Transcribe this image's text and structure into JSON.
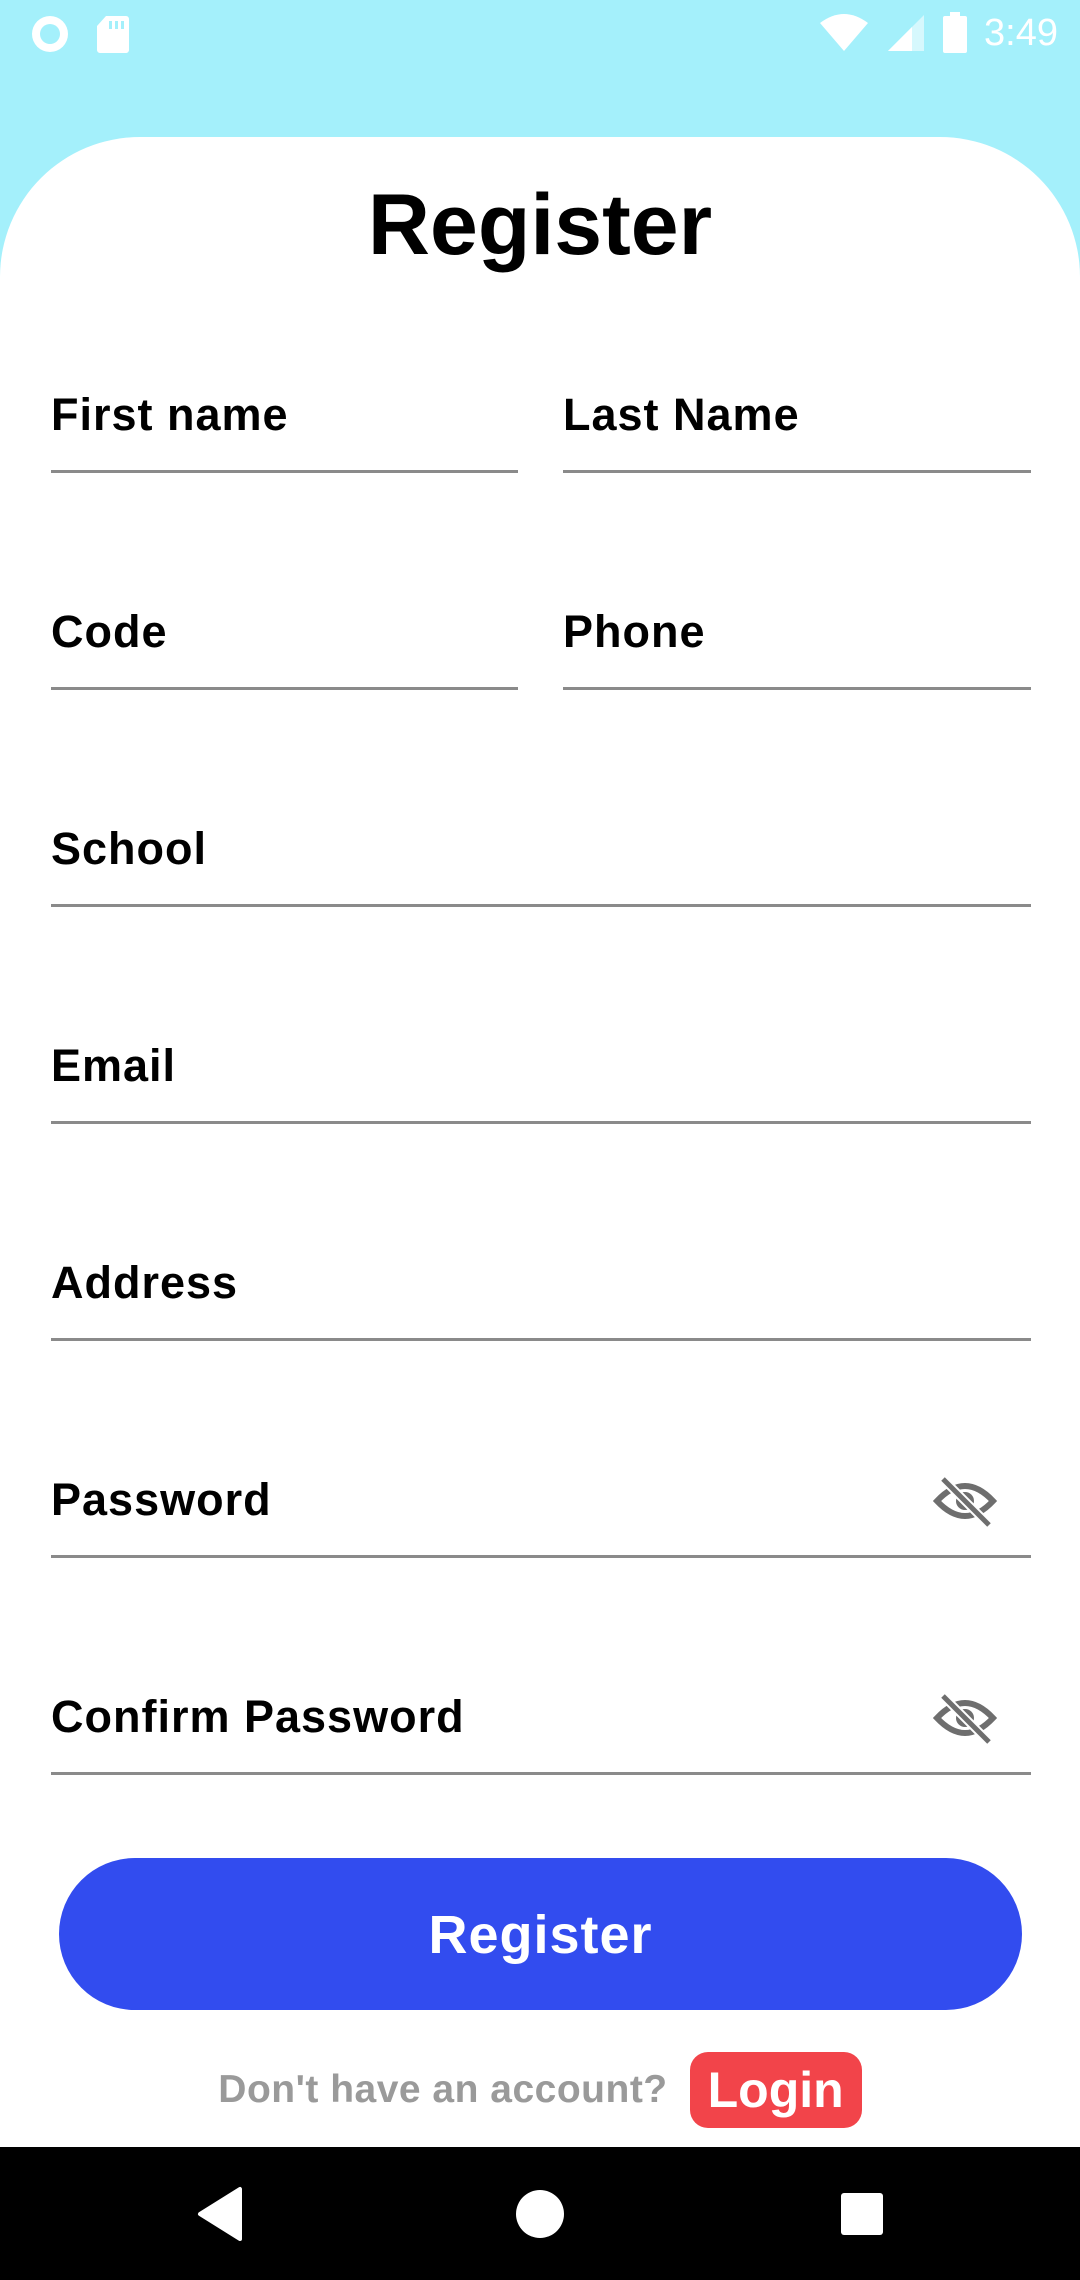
{
  "status_bar": {
    "time": "3:49",
    "icons_left": [
      "record-icon",
      "sd-card-icon"
    ],
    "icons_right": [
      "wifi-icon",
      "signal-icon",
      "battery-icon"
    ]
  },
  "title": "Register",
  "fields": {
    "first_name": {
      "label": "First name",
      "value": ""
    },
    "last_name": {
      "label": "Last Name",
      "value": ""
    },
    "code": {
      "label": "Code",
      "value": ""
    },
    "phone": {
      "label": "Phone",
      "value": ""
    },
    "school": {
      "label": "School",
      "value": ""
    },
    "email": {
      "label": "Email",
      "value": ""
    },
    "address": {
      "label": "Address",
      "value": ""
    },
    "password": {
      "label": "Password",
      "value": "",
      "icon": "eye-off-icon"
    },
    "confirm_password": {
      "label": "Confirm Password",
      "value": "",
      "icon": "eye-off-icon"
    }
  },
  "register_button": "Register",
  "footer": {
    "prompt": "Don't have an account?",
    "login_link": "Login"
  },
  "nav_bar": {
    "buttons": [
      "back-icon",
      "home-icon",
      "recents-icon"
    ]
  },
  "colors": {
    "background": "#a4f0fb",
    "card": "#ffffff",
    "primary_button": "#324cef",
    "login_link": "#f2444a",
    "underline": "#8a8a8a",
    "footer_text": "#9a9a9a"
  }
}
